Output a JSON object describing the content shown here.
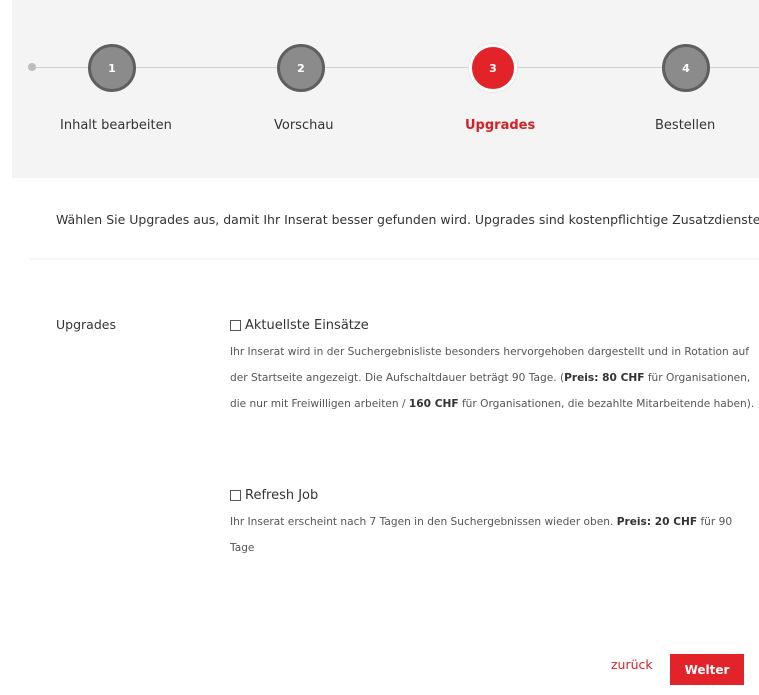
{
  "wizard": {
    "steps": [
      {
        "number": "1",
        "label": "Inhalt bearbeiten",
        "state": "inactive"
      },
      {
        "number": "2",
        "label": "Vorschau",
        "state": "inactive"
      },
      {
        "number": "3",
        "label": "Upgrades",
        "state": "active"
      },
      {
        "number": "4",
        "label": "Bestellen",
        "state": "inactive"
      }
    ],
    "active_color": "#e2232a",
    "inactive_color": "#8b8b8b"
  },
  "intro_text": "Wählen Sie Upgrades aus, damit Ihr Inserat besser gefunden wird. Upgrades sind kostenpflichtige Zusatzdienste.",
  "form": {
    "section_label": "Upgrades",
    "options": [
      {
        "title": "Aktuellste Einsätze",
        "checked": false,
        "desc_1": "Ihr Inserat wird in der Suchergebnisliste besonders hervorgehoben dargestellt und in Rotation auf der Startseite angezeigt. Die Aufschaltdauer beträgt 90 Tage. (",
        "price_1": "Preis: 80 CHF",
        "desc_2": " für Organisationen, die nur mit Freiwilligen arbeiten / ",
        "price_2": "160 CHF",
        "desc_3": " für Organisationen, die bezahlte Mitarbeitende haben)."
      },
      {
        "title": "Refresh Job",
        "checked": false,
        "desc_1": "Ihr Inserat erscheint nach 7 Tagen in den Suchergebnissen wieder oben. ",
        "price_1": "Preis: 20 CHF",
        "desc_2": " für 90 Tage"
      }
    ]
  },
  "actions": {
    "back_label": "zurück",
    "next_label": "Welter"
  }
}
